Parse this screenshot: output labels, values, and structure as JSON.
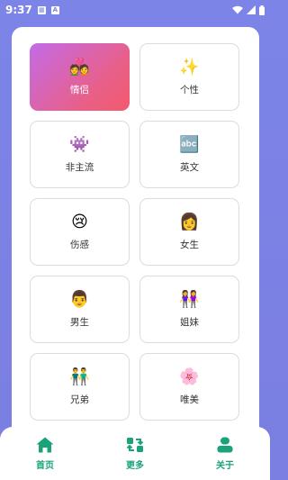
{
  "status_bar": {
    "time": "9:37"
  },
  "categories": [
    {
      "emoji": "💑",
      "label": "情侣",
      "selected": true
    },
    {
      "emoji": "✨",
      "label": "个性"
    },
    {
      "emoji": "👾",
      "label": "非主流"
    },
    {
      "emoji": "🔤",
      "label": "英文"
    },
    {
      "emoji": "😢",
      "label": "伤感"
    },
    {
      "emoji": "👩",
      "label": "女生"
    },
    {
      "emoji": "👨",
      "label": "男生"
    },
    {
      "emoji": "👭",
      "label": "姐妹"
    },
    {
      "emoji": "👬",
      "label": "兄弟"
    },
    {
      "emoji": "🌸",
      "label": "唯美"
    }
  ],
  "tabs": [
    {
      "label": "首页",
      "icon": "home-icon"
    },
    {
      "label": "更多",
      "icon": "refresh-icon"
    },
    {
      "label": "关于",
      "icon": "person-icon"
    }
  ],
  "colors": {
    "accent": "#1aa37a",
    "background": "#7d84e8",
    "selected_from": "#c36be8",
    "selected_to": "#f25a6e"
  }
}
